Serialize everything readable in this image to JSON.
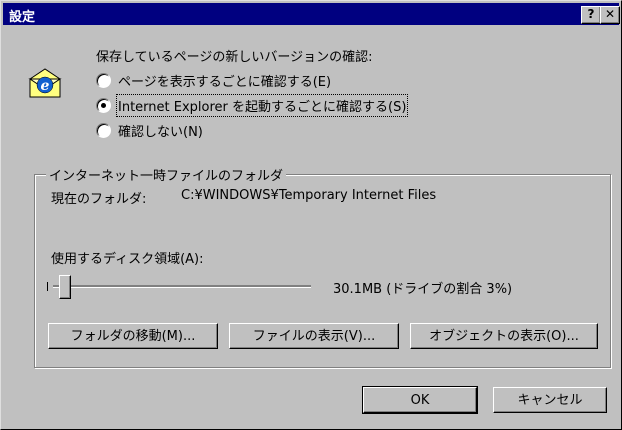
{
  "window": {
    "title": "設定",
    "help_label": "?",
    "close_label": "✕"
  },
  "check_newer": {
    "label": "保存しているページの新しいバージョンの確認:",
    "options": [
      {
        "label": "ページを表示するごとに確認する(E)",
        "checked": false
      },
      {
        "label": "Internet Explorer を起動するごとに確認する(S)",
        "checked": true
      },
      {
        "label": "確認しない(N)",
        "checked": false
      }
    ]
  },
  "temp_folder": {
    "group_label": "インターネット一時ファイルのフォルダ",
    "current_folder_label": "現在のフォルダ:",
    "current_folder_path": "C:¥WINDOWS¥Temporary Internet Files",
    "disk_space_label": "使用するディスク領域(A):",
    "disk_space_value": "30.1MB (ドライブの割合 3%)",
    "disk_space_percent": 3
  },
  "buttons": {
    "move_folder": "フォルダの移動(M)...",
    "view_files": "ファイルの表示(V)...",
    "view_objects": "オブジェクトの表示(O)...",
    "ok": "OK",
    "cancel": "キャンセル"
  },
  "icons": {
    "app": "ie-icon"
  },
  "colors": {
    "titlebar": "#000080",
    "face": "#c0c0c0"
  }
}
